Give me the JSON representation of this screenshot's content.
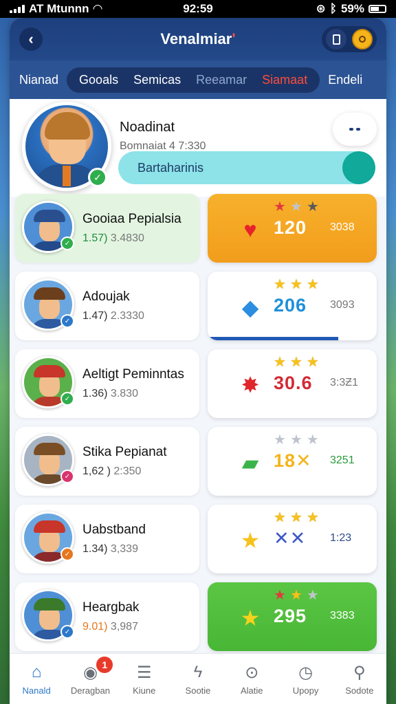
{
  "status_bar": {
    "carrier": "AT Mtunnn",
    "time": "92:59",
    "battery": "59%"
  },
  "header": {
    "title_main": "Venalmiar",
    "title_accent": "'",
    "back_icon": "chevron-left-icon"
  },
  "tabs": [
    {
      "label": "Nianad",
      "style": "plain"
    },
    {
      "label": "Gooals",
      "style": "active"
    },
    {
      "label": "Semicas",
      "style": "active"
    },
    {
      "label": "Reeamar",
      "style": "muted"
    },
    {
      "label": "Siamaat",
      "style": "red"
    },
    {
      "label": "Endeli",
      "style": "plain"
    }
  ],
  "profile": {
    "name": "Noadinat",
    "subtitle": "Bomnaiat 4 7:330",
    "pill_label": "Bartaharinis"
  },
  "rows": [
    {
      "name": "Gooiaa Pepialsia",
      "stat_lead": "1.57)",
      "stat_rest": "3.4830",
      "lead_color": "green",
      "badge_color": "#2fae4d",
      "badge_text": "✓",
      "avatar_bg": "#4f8fd6",
      "hat_color": "#2a4f8f",
      "body_color": "#234a8a",
      "highlight": true,
      "card_style": "orange",
      "stars": [
        "red",
        "grey",
        "dark"
      ],
      "icon": "heart-icon",
      "icon_glyph": "♥",
      "icon_color": "#e8222a",
      "value": "120",
      "extra": "3038"
    },
    {
      "name": "Adoujak",
      "stat_lead": "1.47)",
      "stat_rest": "2.3330",
      "lead_color": "",
      "badge_color": "#2c78c9",
      "badge_text": "✓",
      "avatar_bg": "#6aa7e0",
      "hat_color": "#6b3f1c",
      "body_color": "#2d5aa0",
      "highlight": false,
      "card_style": "white",
      "underline": true,
      "stars": [
        "gold",
        "gold",
        "gold"
      ],
      "icon": "bird-icon",
      "icon_glyph": "◆",
      "icon_color": "#2c8ee0",
      "value": "206",
      "value_color": "#1f8fd8",
      "extra": "3093"
    },
    {
      "name": "Aeltigt Peminntas",
      "stat_lead": "1.36)",
      "stat_rest": "3.830",
      "lead_color": "",
      "badge_color": "#2fae4d",
      "badge_text": "✓",
      "avatar_bg": "#5ab04a",
      "hat_color": "#c8352a",
      "body_color": "#b83a2a",
      "highlight": false,
      "card_style": "white",
      "stars": [
        "gold",
        "gold",
        "gold"
      ],
      "icon": "star-burst-icon",
      "icon_glyph": "✸",
      "icon_color": "#e0262a",
      "value": "30.6",
      "value_color": "#d42a36",
      "extra": "3:3Ƶ1"
    },
    {
      "name": "Stika Pepianat",
      "stat_lead": "1,62 )",
      "stat_rest": "2:350",
      "lead_color": "",
      "badge_color": "#d8336e",
      "badge_text": "✓",
      "avatar_bg": "#a7b4c4",
      "hat_color": "#7a4e24",
      "body_color": "#6b4a2c",
      "highlight": false,
      "card_style": "white",
      "stars": [
        "grey",
        "grey",
        "grey"
      ],
      "icon": "bag-icon",
      "icon_glyph": "▰",
      "icon_color": "#3ab44a",
      "value": "18✕",
      "value_color": "#f4b41a",
      "extra": "3251",
      "extra_color": "#2a9a3a"
    },
    {
      "name": "Uabstband",
      "stat_lead": "1.34)",
      "stat_rest": "3,339",
      "lead_color": "",
      "badge_color": "#e5771e",
      "badge_text": "✓",
      "avatar_bg": "#6aa7e0",
      "hat_color": "#c8352a",
      "body_color": "#8a2a2a",
      "highlight": false,
      "card_style": "white",
      "stars": [
        "gold",
        "gold",
        "gold"
      ],
      "icon": "star-icon",
      "icon_glyph": "★",
      "icon_color": "#f6c21c",
      "value": "✕✕",
      "value_color": "#3d57c9",
      "extra": "1:23",
      "extra_color": "#2d4a8a"
    },
    {
      "name": "Heargbak",
      "stat_lead": "9.01)",
      "stat_rest": "3,987",
      "lead_color": "orange",
      "badge_color": "#2c78c9",
      "badge_text": "✓",
      "avatar_bg": "#4f8fd6",
      "hat_color": "#3a7a2a",
      "body_color": "#2d5aa0",
      "highlight": false,
      "card_style": "green",
      "stars": [
        "red",
        "gold",
        "grey"
      ],
      "icon": "star-icon",
      "icon_glyph": "★",
      "icon_color": "#f6d21c",
      "value": "295",
      "extra": "3383"
    }
  ],
  "bottom_nav": [
    {
      "label": "Nanald",
      "icon": "home-icon",
      "glyph": "⌂",
      "active": true
    },
    {
      "label": "Deragban",
      "icon": "compass-icon",
      "glyph": "◉",
      "active": false,
      "badge": "1"
    },
    {
      "label": "Kiune",
      "icon": "list-icon",
      "glyph": "☰",
      "active": false
    },
    {
      "label": "Sootie",
      "icon": "bolt-icon",
      "glyph": "ϟ",
      "active": false
    },
    {
      "label": "Alatie",
      "icon": "dots-icon",
      "glyph": "⊙",
      "active": false
    },
    {
      "label": "Upopy",
      "icon": "bag-icon",
      "glyph": "◷",
      "active": false
    },
    {
      "label": "Sodote",
      "icon": "search-icon",
      "glyph": "⚲",
      "active": false
    }
  ]
}
